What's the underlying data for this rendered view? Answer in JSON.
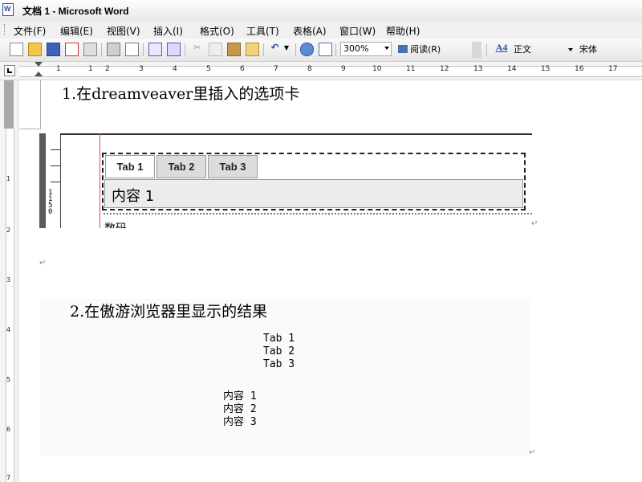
{
  "window": {
    "title": "文档 1 - Microsoft Word"
  },
  "menubar": {
    "items": [
      "文件(F)",
      "编辑(E)",
      "视图(V)",
      "插入(I)",
      "格式(O)",
      "工具(T)",
      "表格(A)",
      "窗口(W)",
      "帮助(H)"
    ]
  },
  "toolbar": {
    "zoom": "300%",
    "read_label": "阅读(R)",
    "style": "正文",
    "font": "宋体",
    "style_icon_text": "A4"
  },
  "ruler": {
    "numbers": [
      "1",
      "1",
      "2",
      "3",
      "4",
      "5",
      "6",
      "7",
      "8",
      "9",
      "10",
      "11",
      "12",
      "13",
      "14",
      "15",
      "16",
      "17"
    ]
  },
  "vruler": {
    "numbers": [
      "1",
      "2",
      "3",
      "4",
      "5",
      "6",
      "7"
    ]
  },
  "document": {
    "heading1": "1.在dreamveaver里插入的选项卡",
    "dw": {
      "tabs": [
        "Tab 1",
        "Tab 2",
        "Tab 3"
      ],
      "panel_text": "内容 1",
      "cut_text": "数码",
      "side_numbers": "1\n1\n5\n0"
    },
    "heading2": "2.在傲游浏览器里显示的结果",
    "browser": {
      "tabs": [
        "Tab 1",
        "Tab 2",
        "Tab 3"
      ],
      "contents": [
        "内容 1",
        "内容 2",
        "内容 3"
      ]
    },
    "pilcrow": "↵"
  }
}
